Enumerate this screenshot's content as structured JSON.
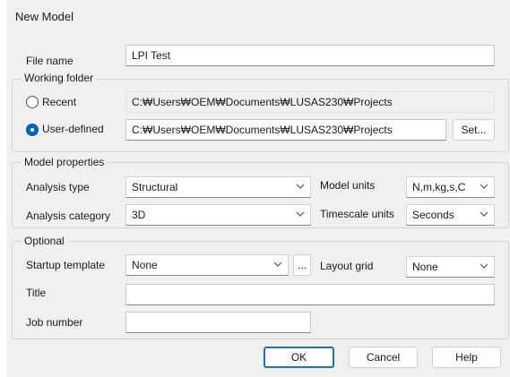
{
  "window": {
    "title": "New Model"
  },
  "file": {
    "label": "File name",
    "value": "LPI Test"
  },
  "working_folder": {
    "legend": "Working folder",
    "recent": {
      "label": "Recent",
      "value": "C:₩Users₩OEM₩Documents₩LUSAS230₩Projects",
      "selected": false
    },
    "user_defined": {
      "label": "User-defined",
      "value": "C:₩Users₩OEM₩Documents₩LUSAS230₩Projects",
      "selected": true
    },
    "set_button": "Set..."
  },
  "model_properties": {
    "legend": "Model properties",
    "analysis_type": {
      "label": "Analysis type",
      "value": "Structural"
    },
    "analysis_category": {
      "label": "Analysis category",
      "value": "3D"
    },
    "model_units": {
      "label": "Model units",
      "value": "N,m,kg,s,C"
    },
    "timescale_units": {
      "label": "Timescale units",
      "value": "Seconds"
    }
  },
  "optional": {
    "legend": "Optional",
    "startup_template": {
      "label": "Startup template",
      "value": "None",
      "browse": "..."
    },
    "layout_grid": {
      "label": "Layout grid",
      "value": "None"
    },
    "title": {
      "label": "Title",
      "value": ""
    },
    "job_number": {
      "label": "Job number",
      "value": ""
    }
  },
  "buttons": {
    "ok": "OK",
    "cancel": "Cancel",
    "help": "Help"
  },
  "colors": {
    "accent": "#0067c0",
    "default_border": "#1f6fc8",
    "dialog_bg": "#f0f0f0"
  },
  "icons": {
    "dropdown": "chevron-down-icon"
  }
}
